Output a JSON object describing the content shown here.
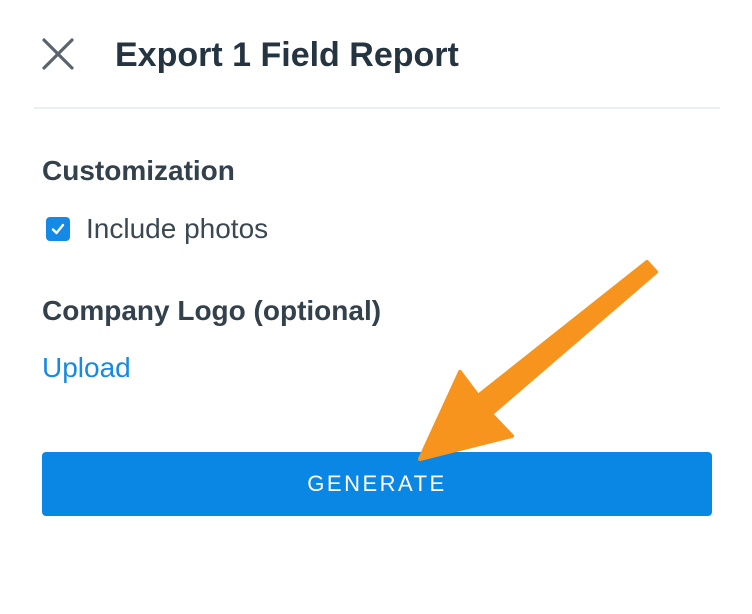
{
  "dialog": {
    "title": "Export 1 Field Report"
  },
  "customization": {
    "heading": "Customization",
    "include_photos_label": "Include photos",
    "include_photos_checked": true
  },
  "logo": {
    "heading": "Company Logo (optional)",
    "upload_label": "Upload"
  },
  "actions": {
    "generate_label": "GENERATE"
  },
  "colors": {
    "primary": "#0a86e4",
    "link": "#168ae0",
    "text": "#2e3b46",
    "annotation_arrow": "#f7941e"
  },
  "icons": {
    "close": "close-icon",
    "checkbox": "checkmark-icon",
    "annotation": "arrow-annotation-icon"
  }
}
